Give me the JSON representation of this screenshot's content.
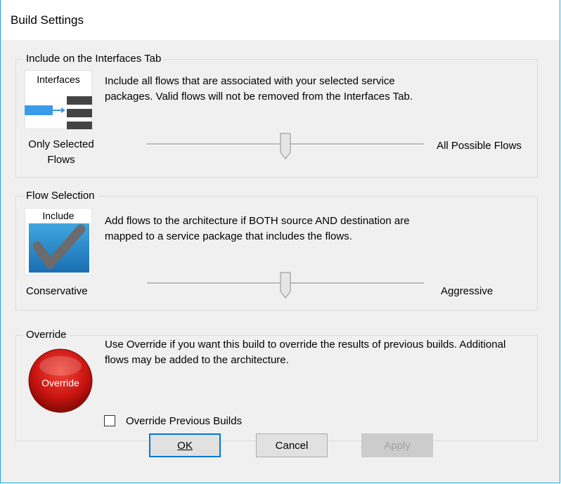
{
  "window": {
    "title": "Build Settings"
  },
  "interfaces_group": {
    "legend": "Include on the Interfaces Tab",
    "icon_label": "Interfaces",
    "description": "Include all flows that are associated with your selected service packages.  Valid flows will not be removed from the Interfaces Tab.",
    "left_label": "Only Selected Flows",
    "right_label": "All Possible Flows",
    "slider_level": 0.5
  },
  "flow_selection_group": {
    "legend": "Flow Selection",
    "icon_label": "Include",
    "description": "Add flows to the architecture if BOTH source AND destination are mapped to a service package that includes the flows.",
    "left_label": "Conservative",
    "right_label": "Aggressive",
    "slider_level": 0.5
  },
  "override_group": {
    "legend": "Override",
    "icon_label": "Override",
    "description": "Use Override if you want this build to override the results of previous builds.  Additional flows may be added to the architecture.",
    "checkbox_label": "Override Previous Builds",
    "checked": false
  },
  "buttons": {
    "ok": "OK",
    "cancel": "Cancel",
    "apply": "Apply"
  },
  "colors": {
    "accent": "#0078d7",
    "border": "#22a6d8",
    "override_red": "#c8140f"
  }
}
